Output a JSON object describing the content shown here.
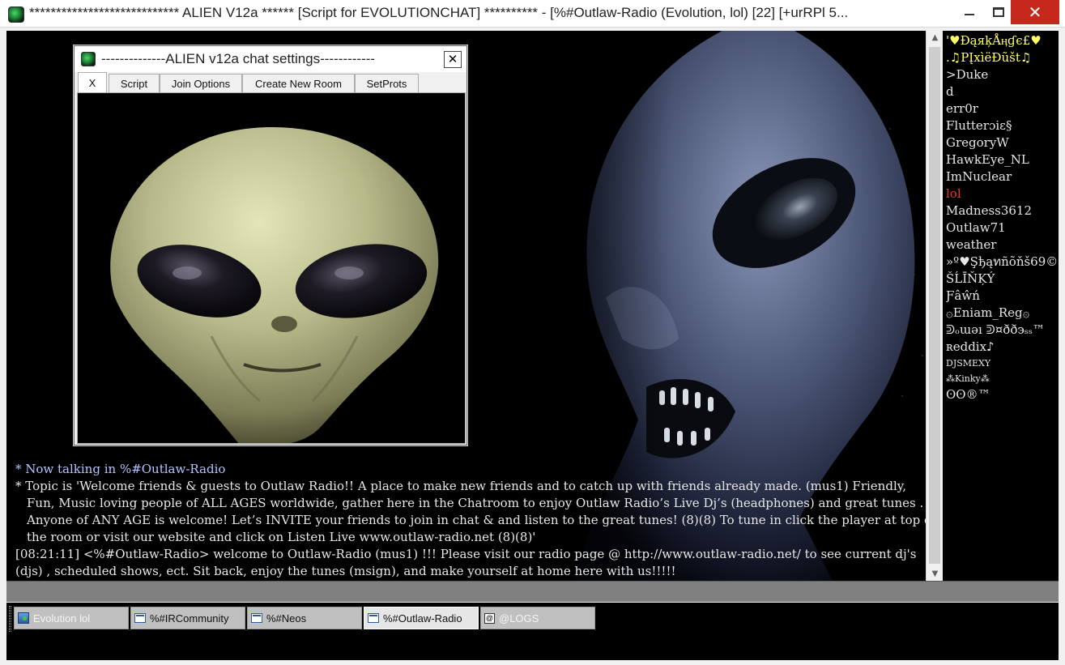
{
  "window": {
    "title": "**************************** ALIEN V12a ****** [Script for EVOLUTIONCHAT] ********** - [%#Outlaw-Radio (Evolution, lol) [22] [+urRPl 5...",
    "close_glyph": "✕"
  },
  "dialog": {
    "title": "--------------ALIEN v12a chat settings------------",
    "close_glyph": "✕",
    "tabs": [
      {
        "label": "X"
      },
      {
        "label": "Script"
      },
      {
        "label": "Join Options"
      },
      {
        "label": "Create New Room"
      },
      {
        "label": "SetProts"
      }
    ]
  },
  "chat": {
    "lines": [
      "* Now talking in %#Outlaw-Radio",
      "* Topic is 'Welcome friends & guests to Outlaw Radio!! A place to make new friends and to catch up with friends already made. (mus1)   Friendly,",
      "Fun, Music loving people of ALL AGES worldwide, gather here in the Chatroom to enjoy Outlaw Radio’s Live Dj’s (headphones) and great tunes .",
      "Anyone of ANY AGE is welcome! Let’s INVITE your friends to join in chat & and listen to the great tunes! (8)(8) To tune in click the player at top of",
      "the room or visit our website and click on Listen Live  www.outlaw-radio.net (8)(8)'",
      "[08:21:11] <%#Outlaw-Radio> welcome to Outlaw-Radio (mus1) !!! Please visit our radio page @ http://www.outlaw-radio.net/ to see current dj's",
      "(djs) , scheduled shows, ect. Sit back, enjoy the tunes (msign), and make yourself at home here with us!!!!!"
    ]
  },
  "nicks": [
    {
      "name": "'♥ĐąяķÅӊɠє£♥",
      "color": "#ffff66"
    },
    {
      "name": ".♫PĮxìëĐũšt♫",
      "color": "#ffff66"
    },
    {
      "name": ">Duke",
      "color": "#e6e6e6"
    },
    {
      "name": "d",
      "color": "#e6e6e6"
    },
    {
      "name": "err0r",
      "color": "#e6e6e6"
    },
    {
      "name": "Flutterɔiɛ§",
      "color": "#e6e6e6"
    },
    {
      "name": "GregoryW",
      "color": "#e6e6e6"
    },
    {
      "name": "HawkEye_NL",
      "color": "#e6e6e6"
    },
    {
      "name": "ImNuclear",
      "color": "#e6e6e6"
    },
    {
      "name": "lol",
      "color": "#ff2a2a"
    },
    {
      "name": "Madness3612",
      "color": "#e6e6e6"
    },
    {
      "name": "Outlaw71",
      "color": "#e6e6e6"
    },
    {
      "name": "weather",
      "color": "#e6e6e6"
    },
    {
      "name": "»º♥Şђąทñõňš69©",
      "color": "#e6e6e6"
    },
    {
      "name": "ŠĹĪŇĶÝ",
      "color": "#e6e6e6"
    },
    {
      "name": "Ƒâŵń",
      "color": "#e6e6e6"
    },
    {
      "name": "۞Eniam_Reg۞",
      "color": "#e6e6e6"
    },
    {
      "name": "ᕲₒɯǝı ᕲ¤ðð϶ₛₛ™",
      "color": "#e6e6e6"
    },
    {
      "name": "ʀeddix♪",
      "color": "#e6e6e6"
    },
    {
      "name": "DJSMEXY",
      "color": "#e6e6e6",
      "small": true
    },
    {
      "name": "⁂Kinky⁂",
      "color": "#e6e6e6",
      "small": true
    },
    {
      "name": "ʘʘ®™",
      "color": "#e6e6e6"
    }
  ],
  "switchbar": {
    "tabs": [
      {
        "label": "Evolution lol",
        "icon": "status-icon",
        "active": false,
        "dim": true
      },
      {
        "label": "%#IRCommunity",
        "icon": "channel-icon",
        "active": false,
        "dim": false
      },
      {
        "label": "%#Neos",
        "icon": "channel-icon",
        "active": false,
        "dim": false
      },
      {
        "label": "%#Outlaw-Radio",
        "icon": "channel-icon",
        "active": true,
        "dim": false
      },
      {
        "label": "@LOGS",
        "icon": "logs-icon",
        "active": false,
        "dim": true
      }
    ]
  },
  "colors": {
    "accent_close": "#c7281c",
    "chat_text": "#e8e8e8",
    "highlight_nick": "#ff2a2a"
  }
}
